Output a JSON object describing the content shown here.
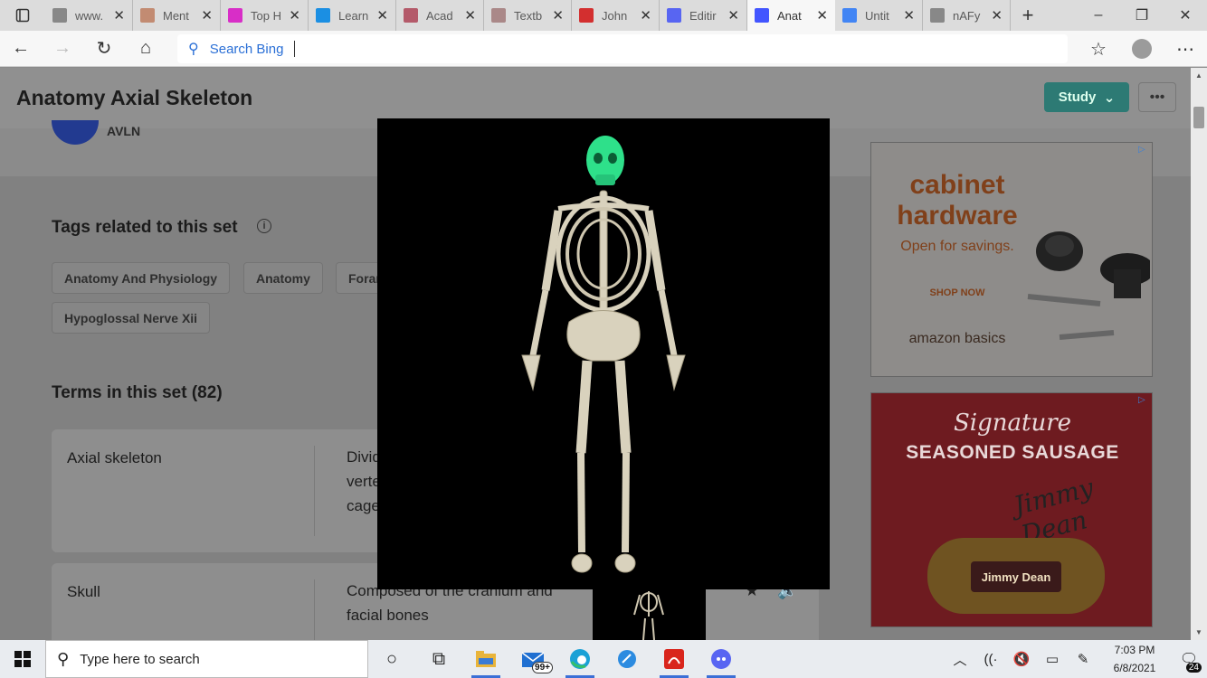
{
  "browser": {
    "tabs": [
      {
        "label": "www.",
        "icon": "page-icon",
        "color": "#888888"
      },
      {
        "label": "Ment",
        "icon": "mentimeter-icon",
        "color": "#c28b72"
      },
      {
        "label": "Top H",
        "icon": "t-logo-icon",
        "color": "#d82ec7"
      },
      {
        "label": "Learn",
        "icon": "k-logo-icon",
        "color": "#1b8fe3"
      },
      {
        "label": "Acad",
        "icon": "my-logo-icon",
        "color": "#b45a6a"
      },
      {
        "label": "Textb",
        "icon": "textbook-icon",
        "color": "#a88"
      },
      {
        "label": "John",
        "icon": "pdf-icon",
        "color": "#d32f2f"
      },
      {
        "label": "Editir",
        "icon": "discord-icon",
        "color": "#5865f2"
      },
      {
        "label": "Anat",
        "icon": "quizlet-icon",
        "color": "#4255ff"
      },
      {
        "label": "Untit",
        "icon": "docs-icon",
        "color": "#4285f4"
      },
      {
        "label": "nAFy",
        "icon": "blank-page-icon",
        "color": "#888888"
      }
    ],
    "active_tab": 8,
    "address_placeholder": "Search Bing"
  },
  "page": {
    "title": "Anatomy Axial Skeleton",
    "study_label": "Study",
    "more_label": "•••",
    "creator": "AVLN",
    "tags_heading": "Tags related to this set",
    "tags": [
      "Anatomy And Physiology",
      "Anatomy",
      "Forar",
      "Hypoglossal Nerve Xii"
    ],
    "terms_heading": "Terms in this set (82)",
    "terms": [
      {
        "word": "Axial skeleton",
        "definition": "Divid\nverte\ncage"
      },
      {
        "word": "Skull",
        "definition": "Composed of the cranium and facial bones"
      }
    ]
  },
  "ads": {
    "ad1": {
      "headline": "cabinet hardware",
      "sub": "Open for savings.",
      "cta": "SHOP NOW",
      "brand": "amazon basics"
    },
    "ad2": {
      "script": "Signature",
      "headline": "SEASONED SAUSAGE",
      "signature": "Jimmy Dean",
      "product": "Jimmy Dean"
    }
  },
  "taskbar": {
    "search_placeholder": "Type here to search",
    "mail_badge": "99+",
    "time": "7:03 PM",
    "date": "6/8/2021",
    "notifications": "24"
  },
  "colors": {
    "accent": "#2d7a74",
    "skull_highlight": "#2ee08a",
    "bone": "#d9d2bd"
  }
}
